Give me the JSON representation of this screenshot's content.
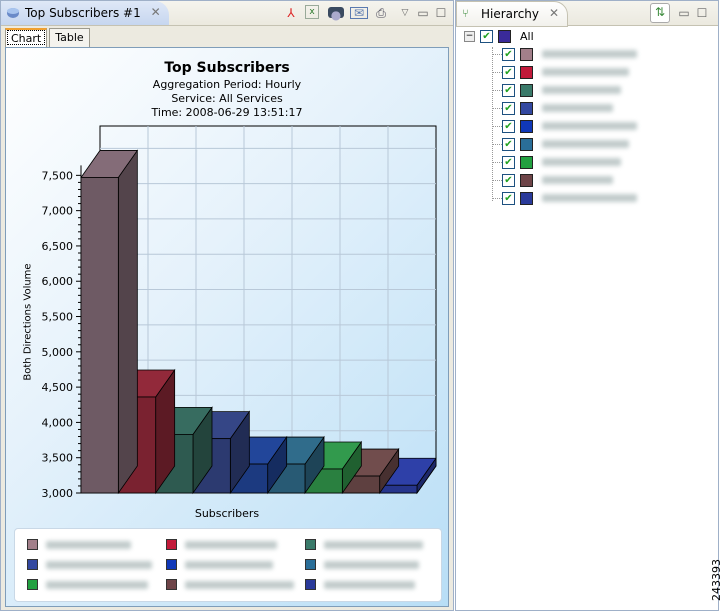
{
  "editor": {
    "tab_title": "Top Subscribers #1",
    "subtabs": [
      "Chart",
      "Table"
    ]
  },
  "hierarchy": {
    "tab_title": "Hierarchy",
    "root": "All",
    "root_color": "#3a2a9a",
    "item_colors": [
      "#a27f8a",
      "#c21a3a",
      "#3a7a6a",
      "#3348a0",
      "#1038b8",
      "#2a6e98",
      "#22a040",
      "#6e4448",
      "#2a3a9a"
    ]
  },
  "figure_id": "243393",
  "chart_data": {
    "type": "bar",
    "title": "Top Subscribers",
    "subtitles": [
      "Aggregation Period: Hourly",
      "Service: All Services",
      "Time: 2008-06-29 13:51:17"
    ],
    "xlabel": "Subscribers",
    "ylabel": "Both Directions Volume",
    "ylim": [
      3000,
      7830
    ],
    "yticks": [
      "3,000",
      "3,500",
      "4,000",
      "4,500",
      "5,000",
      "5,500",
      "6,000",
      "6,500",
      "7,000",
      "7,500"
    ],
    "values": [
      7470,
      4360,
      3830,
      3770,
      3410,
      3410,
      3340,
      3240,
      3110
    ],
    "colors": [
      "#6e5a64",
      "#7a2230",
      "#2e5a50",
      "#2c3a70",
      "#1c3a80",
      "#285a74",
      "#2a8040",
      "#5e4040",
      "#26358c"
    ],
    "legend_colors": [
      "#a27f8a",
      "#c21a3a",
      "#3a7a6a",
      "#3348a0",
      "#1038b8",
      "#2a6e98",
      "#22a040",
      "#6e4448",
      "#2a3a9a"
    ],
    "grid": true,
    "legend": "bottom"
  }
}
